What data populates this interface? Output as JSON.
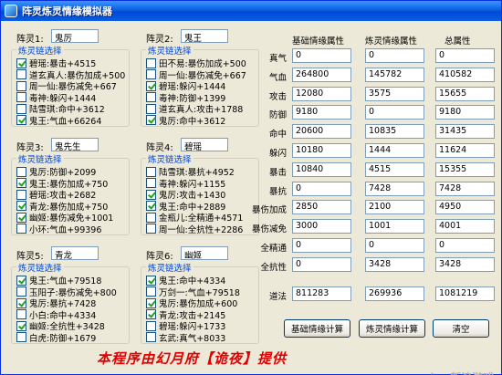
{
  "window": {
    "title": "阵灵炼灵情缘模拟器"
  },
  "groups": [
    {
      "label": "阵灵1:",
      "value": "鬼厉",
      "group_title": "炼灵链选择",
      "options": [
        {
          "text": "碧瑶:暴击+4515",
          "checked": true
        },
        {
          "text": "道玄真人:暴伤加成+500",
          "checked": false
        },
        {
          "text": "周一仙:暴伤减免+667",
          "checked": false
        },
        {
          "text": "毒神:躲闪+1444",
          "checked": false
        },
        {
          "text": "陆雪琪:命中+3612",
          "checked": false
        },
        {
          "text": "鬼王:气血+66264",
          "checked": true
        }
      ]
    },
    {
      "label": "阵灵2:",
      "value": "鬼王",
      "group_title": "炼灵链选择",
      "options": [
        {
          "text": "田不易:暴伤加成+500",
          "checked": false
        },
        {
          "text": "周一仙:暴伤减免+667",
          "checked": false
        },
        {
          "text": "碧瑶:躲闪+1444",
          "checked": true
        },
        {
          "text": "毒神:防御+1399",
          "checked": false
        },
        {
          "text": "道玄真人:攻击+1788",
          "checked": false
        },
        {
          "text": "鬼厉:命中+3612",
          "checked": true
        }
      ]
    },
    {
      "label": "阵灵3:",
      "value": "鬼先生",
      "group_title": "炼灵链选择",
      "options": [
        {
          "text": "鬼厉:防御+2099",
          "checked": false
        },
        {
          "text": "鬼王:暴伤加成+750",
          "checked": true
        },
        {
          "text": "碧瑶:攻击+2682",
          "checked": false
        },
        {
          "text": "青龙:暴伤加成+750",
          "checked": true
        },
        {
          "text": "幽姬:暴伤减免+1001",
          "checked": true
        },
        {
          "text": "小环:气血+99396",
          "checked": false
        }
      ]
    },
    {
      "label": "阵灵4:",
      "value": "碧瑶",
      "group_title": "炼灵链选择",
      "options": [
        {
          "text": "陆雪琪:暴抗+4952",
          "checked": false
        },
        {
          "text": "毒神:躲闪+1155",
          "checked": false
        },
        {
          "text": "鬼厉:攻击+1430",
          "checked": true
        },
        {
          "text": "鬼王:命中+2889",
          "checked": true
        },
        {
          "text": "金瓶儿:全精通+4571",
          "checked": false
        },
        {
          "text": "周一仙:全抗性+2286",
          "checked": false
        }
      ]
    },
    {
      "label": "阵灵5:",
      "value": "青龙",
      "group_title": "炼灵链选择",
      "options": [
        {
          "text": "鬼王:气血+79518",
          "checked": true
        },
        {
          "text": "玉阳子:暴伤减免+800",
          "checked": false
        },
        {
          "text": "鬼厉:暴抗+7428",
          "checked": true
        },
        {
          "text": "小白:命中+4334",
          "checked": false
        },
        {
          "text": "幽姬:全抗性+3428",
          "checked": true
        },
        {
          "text": "白虎:防御+1679",
          "checked": false
        }
      ]
    },
    {
      "label": "阵灵6:",
      "value": "幽姬",
      "group_title": "炼灵链选择",
      "options": [
        {
          "text": "鬼王:命中+4334",
          "checked": true
        },
        {
          "text": "万剑一:气血+79518",
          "checked": false
        },
        {
          "text": "鬼厉:暴伤加成+600",
          "checked": true
        },
        {
          "text": "青龙:攻击+2145",
          "checked": true
        },
        {
          "text": "碧瑶:躲闪+1733",
          "checked": false
        },
        {
          "text": "玄武:真气+8033",
          "checked": false
        }
      ]
    }
  ],
  "stats": {
    "headers": [
      "基础情缘属性",
      "炼灵情缘属性",
      "总属性"
    ],
    "rows": [
      {
        "label": "真气",
        "values": [
          "0",
          "0",
          "0"
        ]
      },
      {
        "label": "气血",
        "values": [
          "264800",
          "145782",
          "410582"
        ]
      },
      {
        "label": "攻击",
        "values": [
          "12080",
          "3575",
          "15655"
        ]
      },
      {
        "label": "防御",
        "values": [
          "9180",
          "0",
          "9180"
        ]
      },
      {
        "label": "命中",
        "values": [
          "20600",
          "10835",
          "31435"
        ]
      },
      {
        "label": "躲闪",
        "values": [
          "10180",
          "1444",
          "11624"
        ]
      },
      {
        "label": "暴击",
        "values": [
          "10840",
          "4515",
          "15355"
        ]
      },
      {
        "label": "暴抗",
        "values": [
          "0",
          "7428",
          "7428"
        ]
      },
      {
        "label": "暴伤加成",
        "values": [
          "2850",
          "2100",
          "4950"
        ]
      },
      {
        "label": "暴伤减免",
        "values": [
          "3000",
          "1001",
          "4001"
        ]
      },
      {
        "label": "全精通",
        "values": [
          "0",
          "0",
          "0"
        ]
      },
      {
        "label": "全抗性",
        "values": [
          "0",
          "3428",
          "3428"
        ]
      }
    ],
    "daofa": {
      "label": "道法",
      "values": [
        "811283",
        "269936",
        "1081219"
      ]
    }
  },
  "buttons": {
    "basic": "基础情缘计算",
    "lianling": "炼灵情缘计算",
    "clear": "清空"
  },
  "footer": "本程序由幻月府【诡夜】提供",
  "watermark": "sina新浪游戏"
}
